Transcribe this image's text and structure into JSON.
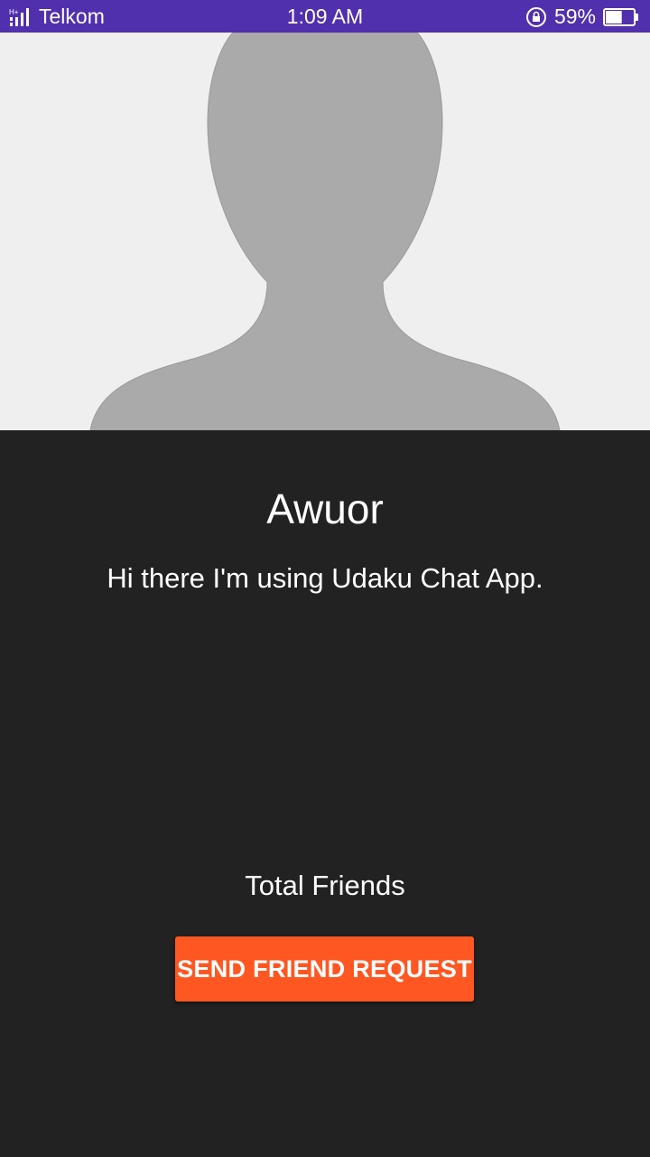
{
  "status_bar": {
    "carrier": "Telkom",
    "time": "1:09 AM",
    "battery_percent": "59%",
    "battery_level": 0.59,
    "background_color": "#5130ad",
    "icons": [
      "signal-icon",
      "rotation-lock-icon",
      "battery-icon"
    ]
  },
  "profile": {
    "image_placeholder": "default-avatar-silhouette",
    "name": "Awuor",
    "status": "Hi there I'm using Udaku Chat App.",
    "total_friends_label": "Total Friends"
  },
  "actions": {
    "send_request_label": "SEND FRIEND REQUEST",
    "accent_color": "#ff5722"
  },
  "colors": {
    "background": "#222222",
    "image_background": "#efefef",
    "silhouette": "#aaaaaa"
  }
}
